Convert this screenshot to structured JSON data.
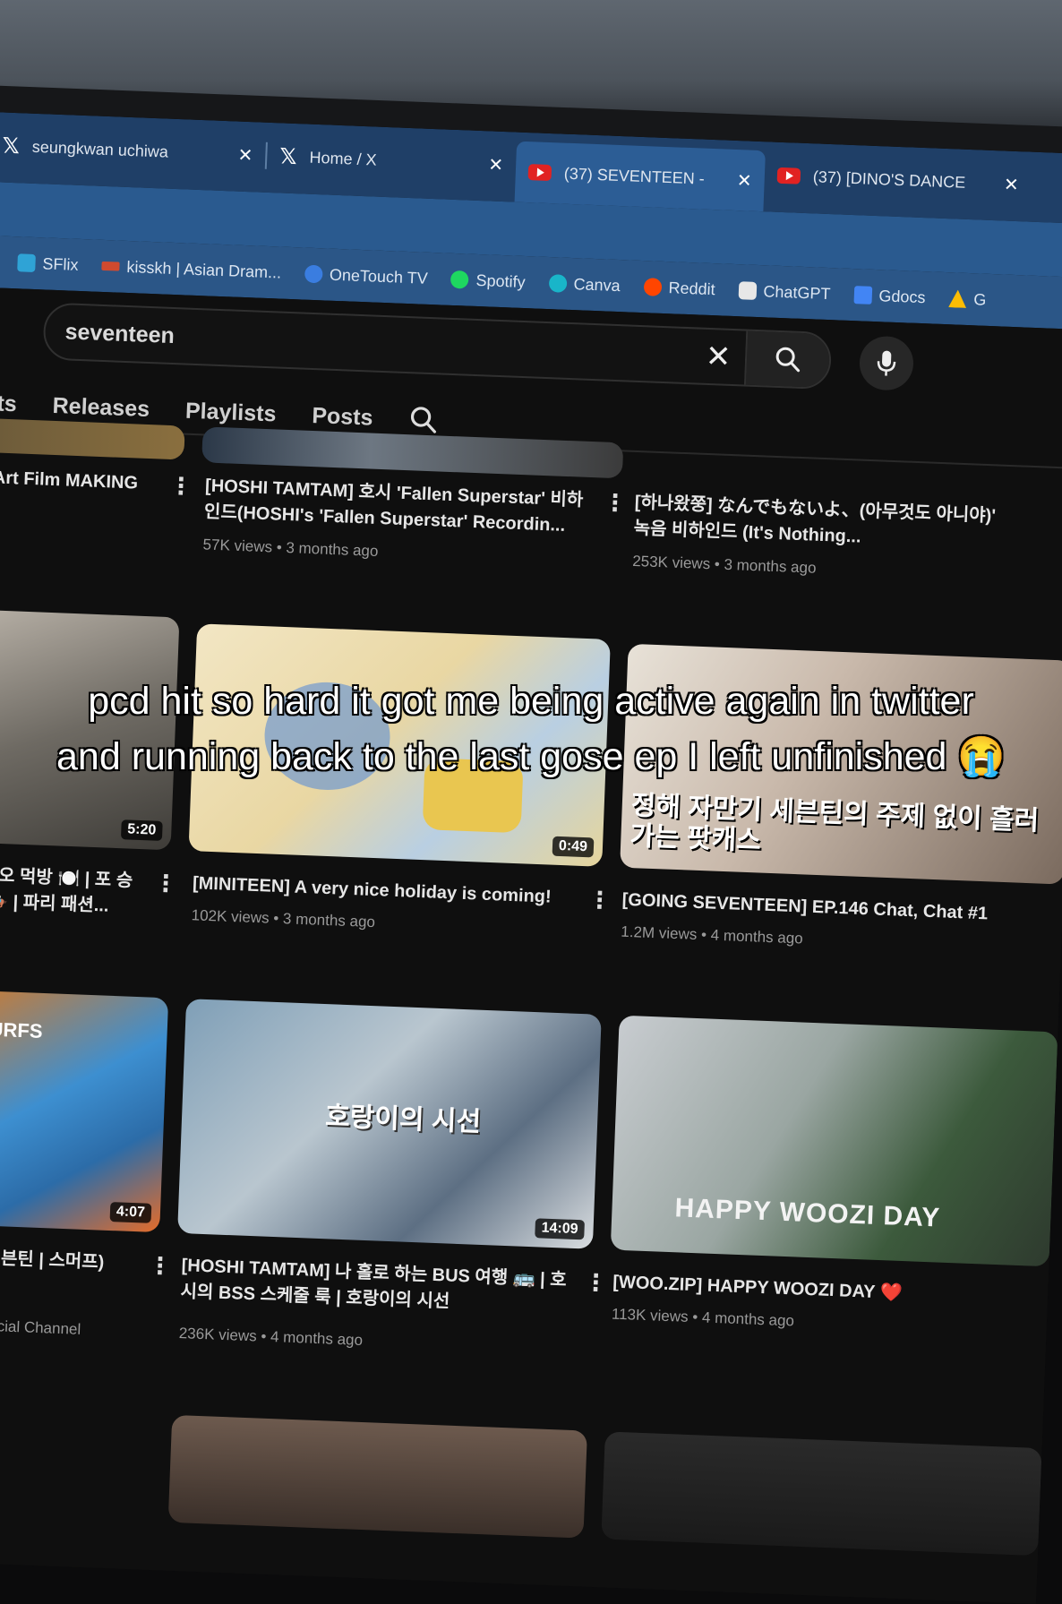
{
  "browser": {
    "tabs": [
      {
        "icon": "x-logo",
        "label": "seungkwan uchiwa"
      },
      {
        "icon": "x-logo",
        "label": "Home / X"
      },
      {
        "icon": "youtube-logo",
        "label": "(37) SEVENTEEN - Y..."
      },
      {
        "icon": "youtube-logo",
        "label": "(37) [DINO'S DANCE"
      }
    ],
    "bookmarks": [
      {
        "icon": "sflix-icon",
        "label": "SFlix",
        "color": "#2fa3d6"
      },
      {
        "icon": "kisskh-icon",
        "label": "kisskh | Asian Dram...",
        "color": "#d04a2f"
      },
      {
        "icon": "onetouch-icon",
        "label": "OneTouch TV",
        "color": "#3a7de0"
      },
      {
        "icon": "spotify-icon",
        "label": "Spotify",
        "color": "#1ed760"
      },
      {
        "icon": "canva-icon",
        "label": "Canva",
        "color": "#19b5c9"
      },
      {
        "icon": "reddit-icon",
        "label": "Reddit",
        "color": "#ff4500"
      },
      {
        "icon": "chatgpt-icon",
        "label": "ChatGPT",
        "color": "#e7e7e7"
      },
      {
        "icon": "gdocs-icon",
        "label": "Gdocs",
        "color": "#4285f4"
      },
      {
        "icon": "gdrive-icon",
        "label": "G",
        "color": "#fbbc04"
      }
    ]
  },
  "youtube": {
    "search": {
      "query": "seventeen"
    },
    "channel_tabs": [
      "orts",
      "Releases",
      "Playlists",
      "Posts"
    ],
    "row1": [
      {
        "title": "' Art Film MAKING",
        "meta": ""
      },
      {
        "title": "[HOSHI TAMTAM] 호시 'Fallen Superstar' 비하인드(HOSHI's 'Fallen Superstar' Recordin...",
        "meta": "57K views • 3 months ago"
      },
      {
        "title": "[하나왔쭝] なんでもないよ、(아무것도 아니야)' 녹음 비하인드 (It's Nothing...",
        "meta": "253K views • 3 months ago"
      }
    ],
    "row2": [
      {
        "title": "공바오 먹방 🍽️ | 포 승마 🏇 | 파리 패션...",
        "meta": "",
        "duration": "5:20"
      },
      {
        "title": "[MINITEEN] A very nice holiday is coming!",
        "meta": "102K views • 3 months ago",
        "duration": "0:49"
      },
      {
        "title": "[GOING SEVENTEEN] EP.146 Chat, Chat #1",
        "meta": "1.2M views • 4 months ago",
        "overlay": "정해 자만기 세븐틴의 주제 없이 흘러가는 팟캐스"
      }
    ],
    "row3": [
      {
        "title": "FS (세븐틴 | 스머프)",
        "meta": "fs • Official Channel",
        "duration": "4:07",
        "overlay": "SMURFS"
      },
      {
        "title": "[HOSHI TAMTAM] 나 홀로 하는 BUS 여행 🚌 | 호시의 BSS 스케줄 룩 | 호랑이의 시선",
        "meta": "236K views • 4 months ago",
        "duration": "14:09",
        "overlay": "호랑이의 시선"
      },
      {
        "title": "[WOO.ZIP] HAPPY WOOZI DAY ❤️",
        "meta": "113K views • 4 months ago",
        "overlay": "HAPPY WOOZI DAY"
      }
    ]
  },
  "caption": "pcd hit so hard it got me being active again in twitter and running back to the last gose ep I left unfinished 😭"
}
